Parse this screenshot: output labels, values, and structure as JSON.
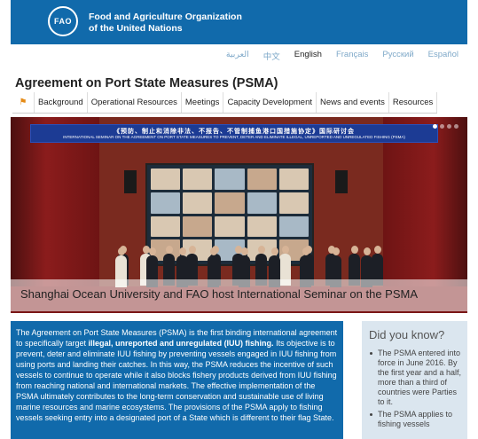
{
  "header": {
    "logo_text": "FAO",
    "org_line1": "Food and Agriculture Organization",
    "org_line2": "of the United Nations",
    "brand_color": "#116aab"
  },
  "languages": [
    "العربية",
    "中文",
    "English",
    "Français",
    "Русский",
    "Español"
  ],
  "active_language": "English",
  "page_title": "Agreement on Port State Measures (PSMA)",
  "nav": {
    "home_icon": "home-icon",
    "items": [
      "Background",
      "Operational Resources",
      "Meetings",
      "Capacity Development",
      "News and events",
      "Resources"
    ]
  },
  "carousel": {
    "banner_line1": "《预防、制止和消除非法、不报告、不管制捕鱼港口国措施协定》国际研讨会",
    "banner_line2": "INTERNATIONAL SEMINAR ON THE AGREEMENT ON PORT STATE MEASURES TO PREVENT, DETER AND ELIMINATE ILLEGAL, UNREPORTED AND UNREGULATED FISHING (PSMA)",
    "caption": "Shanghai Ocean University and FAO host International Seminar on the PSMA",
    "slide_count": 4,
    "active_slide": 1
  },
  "intro": {
    "part1": "The Agreement on Port State Measures (PSMA) is the first binding international agreement to specifically target ",
    "bold": "illegal, unreported and unregulated (IUU) fishing.",
    "part2": " Its objective is to prevent, deter and eliminate IUU fishing by preventing vessels engaged in IUU fishing from using ports and landing their catches. In this way, the PSMA reduces the incentive of such vessels to continue to operate while it also blocks fishery products derived from IUU fishing from reaching national and international markets. The effective implementation of the PSMA ultimately contributes to the long-term conservation and sustainable use of living marine resources and marine ecosystems. The provisions of the PSMA apply to fishing vessels seeking entry into a designated port of a State which is different to their flag State."
  },
  "did_you_know": {
    "title": "Did you know?",
    "items": [
      "The PSMA entered into force in June 2016. By the first year and a half, more than a third of countries were Parties to it.",
      "The PSMA applies to fishing vessels"
    ]
  }
}
